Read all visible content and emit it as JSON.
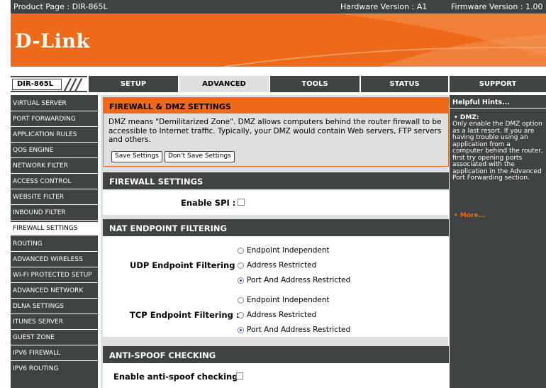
{
  "topbar": {
    "product_page": "Product Page : DIR-865L",
    "hardware_version": "Hardware Version : A1",
    "firmware_version": "Firmware Version : 1.00"
  },
  "banner": {
    "logo": "D-Link"
  },
  "tabbar": {
    "model": "DIR-865L",
    "tabs": [
      "SETUP",
      "ADVANCED",
      "TOOLS",
      "STATUS",
      "SUPPORT"
    ],
    "active_tab": "ADVANCED"
  },
  "leftnav": {
    "items": [
      "VIRTUAL SERVER",
      "PORT FORWARDING",
      "APPLICATION RULES",
      "QOS ENGINE",
      "NETWORK FILTER",
      "ACCESS CONTROL",
      "WEBSITE FILTER",
      "INBOUND FILTER",
      "FIREWALL SETTINGS",
      "ROUTING",
      "ADVANCED WIRELESS",
      "WI-FI PROTECTED SETUP",
      "ADVANCED NETWORK",
      "DLNA SETTINGS",
      "ITUNES SERVER",
      "GUEST ZONE",
      "IPV6 FIREWALL",
      "IPV6 ROUTING"
    ],
    "active_item": "FIREWALL SETTINGS"
  },
  "firewall_dmz": {
    "title": "FIREWALL & DMZ SETTINGS",
    "description": "DMZ means \"Demilitarized Zone\". DMZ allows computers behind the router firewall to be accessible to Internet traffic. Typically, your DMZ would contain Web servers, FTP servers and others.",
    "save_label": "Save Settings",
    "dont_save_label": "Don't Save Settings"
  },
  "firewall_settings": {
    "title": "FIREWALL SETTINGS",
    "enable_spi_label": "Enable SPI :",
    "enable_spi_checked": false
  },
  "nat_filtering": {
    "title": "NAT ENDPOINT FILTERING",
    "udp_label": "UDP Endpoint Filtering :",
    "tcp_label": "TCP Endpoint Filtering :",
    "options": [
      "Endpoint Independent",
      "Address Restricted",
      "Port And Address Restricted"
    ],
    "udp_selected": "Port And Address Restricted",
    "tcp_selected": "Port And Address Restricted"
  },
  "anti_spoof": {
    "title": "ANTI-SPOOF CHECKING",
    "enable_label": "Enable anti-spoof checking :",
    "enable_checked": false
  },
  "hints": {
    "title": "Helpful Hints...",
    "item_title": "DMZ:",
    "item_text": "Only enable the DMZ option as a last resort. If you are having trouble using an application from a computer behind the router, first try opening ports associated with the application in the Advanced Port Forwarding section.",
    "more_label": "More..."
  },
  "colors": {
    "accent": "#ee6a1a",
    "dark": "#404343",
    "panel": "#dfdfdf"
  }
}
